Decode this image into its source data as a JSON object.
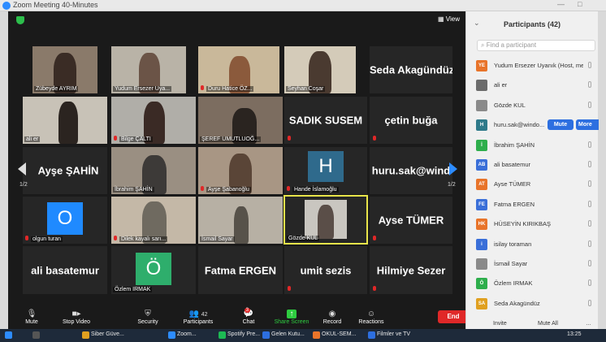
{
  "window": {
    "title": "Zoom Meeting 40-Minutes",
    "view_label": "View"
  },
  "gallery": {
    "page_left": "1/2",
    "page_right": "1/2",
    "tiles": [
      {
        "label": "Zübeyde AYRIM"
      },
      {
        "label": "Yudum Ersezer Uya..."
      },
      {
        "label": "Duru Hatice ÖZ..."
      },
      {
        "label": "Seyhan Coşar"
      },
      {
        "label": "Seda Akagündüz"
      },
      {
        "label": "ali er"
      },
      {
        "label": "Bilge ÇALTI"
      },
      {
        "label": "ŞEREF UMUTLUOĞ..."
      },
      {
        "label": "SADIK SUSEM"
      },
      {
        "label": "çetin buğa"
      },
      {
        "label": "Ayşe ŞAHİN"
      },
      {
        "label": "İbrahim ŞAHİN"
      },
      {
        "label": "Ayşe Şabanoğlu"
      },
      {
        "label": "Hande İslamoğlu",
        "initial": "H"
      },
      {
        "label": "huru.sak@wind"
      },
      {
        "label": "olgun turan",
        "initial": "O"
      },
      {
        "label": "Dilek kayalı sarı..."
      },
      {
        "label": "İsmail Sayar"
      },
      {
        "label": "Gözde KUL"
      },
      {
        "label": "Ayse TÜMER"
      },
      {
        "label": "ali basatemur"
      },
      {
        "label": "Özlem IRMAK",
        "initial": "Ö"
      },
      {
        "label": "Fatma ERGEN"
      },
      {
        "label": "umit sezis"
      },
      {
        "label": "Hilmiye Sezer"
      }
    ]
  },
  "toolbar": {
    "mute": "Mute",
    "stop_video": "Stop Video",
    "security": "Security",
    "participants": "Participants",
    "participants_count": "42",
    "chat": "Chat",
    "chat_badge": "3",
    "share_screen": "Share Screen",
    "record": "Record",
    "reactions": "Reactions",
    "end": "End"
  },
  "panel": {
    "title": "Participants (42)",
    "search_placeholder": "Find a participant",
    "mute_label": "Mute",
    "more_label": "More",
    "invite": "Invite",
    "mute_all": "Mute All",
    "participants": [
      {
        "initials": "YE",
        "name": "Yudum Ersezer Uyanık (Host, me)",
        "color": "#e8742a"
      },
      {
        "initials": "",
        "name": "ali er",
        "color": "#6b6b6b"
      },
      {
        "initials": "",
        "name": "Gözde KUL",
        "color": "#8a8a8a"
      },
      {
        "initials": "H",
        "name": "huru.sak@windo...",
        "color": "#2f7a8a"
      },
      {
        "initials": "İ",
        "name": "İbrahim ŞAHİN",
        "color": "#2eae4c"
      },
      {
        "initials": "AB",
        "name": "ali basatemur",
        "color": "#3a6fd8"
      },
      {
        "initials": "AT",
        "name": "Ayse TÜMER",
        "color": "#e8742a"
      },
      {
        "initials": "FE",
        "name": "Fatma ERGEN",
        "color": "#3a6fd8"
      },
      {
        "initials": "HK",
        "name": "HÜSEYİN KIRIKBAŞ",
        "color": "#e8742a"
      },
      {
        "initials": "i",
        "name": "isilay toraman",
        "color": "#3a6fd8"
      },
      {
        "initials": "",
        "name": "İsmail Sayar",
        "color": "#8a8a8a"
      },
      {
        "initials": "Ö",
        "name": "Özlem IRMAK",
        "color": "#2eae4c"
      },
      {
        "initials": "SA",
        "name": "Seda Akagündüz",
        "color": "#e0a020"
      }
    ]
  },
  "taskbar": {
    "items": [
      "Siber Güve...",
      "Zoom...",
      "Spotify Pre...",
      "Gelen Kutu...",
      "OKUL-SEM...",
      "Filmler ve TV"
    ],
    "time": "13:25"
  }
}
